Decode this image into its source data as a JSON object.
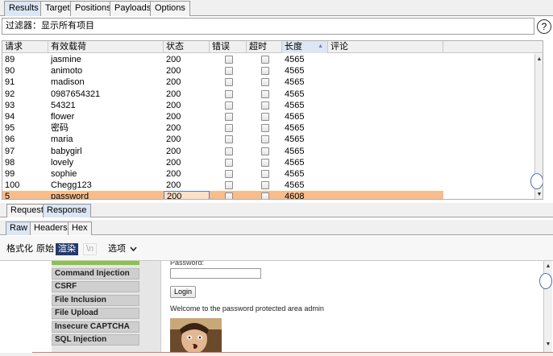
{
  "top_tabs": [
    {
      "label": "Results",
      "active": true
    },
    {
      "label": "Target",
      "active": false
    },
    {
      "label": "Positions",
      "active": false
    },
    {
      "label": "Payloads",
      "active": false
    },
    {
      "label": "Options",
      "active": false
    }
  ],
  "filter": {
    "text": "过滤器：显示所有项目",
    "help": "?"
  },
  "table": {
    "columns": [
      "请求",
      "有效载荷",
      "状态",
      "错误",
      "超时",
      "长度",
      "评论"
    ],
    "sorted_column": "长度",
    "rows": [
      {
        "request": "89",
        "payload": "jasmine",
        "status": "200",
        "length": "4565"
      },
      {
        "request": "90",
        "payload": "animoto",
        "status": "200",
        "length": "4565"
      },
      {
        "request": "91",
        "payload": "madison",
        "status": "200",
        "length": "4565"
      },
      {
        "request": "92",
        "payload": "0987654321",
        "status": "200",
        "length": "4565"
      },
      {
        "request": "93",
        "payload": "54321",
        "status": "200",
        "length": "4565"
      },
      {
        "request": "94",
        "payload": "flower",
        "status": "200",
        "length": "4565"
      },
      {
        "request": "95",
        "payload": "密码",
        "status": "200",
        "length": "4565"
      },
      {
        "request": "96",
        "payload": "maria",
        "status": "200",
        "length": "4565"
      },
      {
        "request": "97",
        "payload": "babygirl",
        "status": "200",
        "length": "4565"
      },
      {
        "request": "98",
        "payload": "lovely",
        "status": "200",
        "length": "4565"
      },
      {
        "request": "99",
        "payload": "sophie",
        "status": "200",
        "length": "4565"
      },
      {
        "request": "100",
        "payload": "Chegg123",
        "status": "200",
        "length": "4565"
      },
      {
        "request": "5",
        "payload": "password",
        "status": "200",
        "length": "4608",
        "selected": true
      }
    ]
  },
  "rr_tabs": [
    {
      "label": "Request",
      "active": false
    },
    {
      "label": "Response",
      "active": true
    }
  ],
  "sub_tabs": [
    {
      "label": "Raw",
      "active": true
    },
    {
      "label": "Headers",
      "active": false
    },
    {
      "label": "Hex",
      "active": false
    }
  ],
  "toolbar": {
    "pretty": "格式化",
    "raw": "原始",
    "render": "渲染",
    "newline": "\\n",
    "options": "选项",
    "chevron": "chevron-down"
  },
  "render": {
    "menu_items": [
      "Command Injection",
      "CSRF",
      "File Inclusion",
      "File Upload",
      "Insecure CAPTCHA",
      "SQL Injection"
    ],
    "password_label": "Password:",
    "login_button": "Login",
    "welcome_text": "Welcome to the password protected area admin"
  },
  "colors": {
    "selected_row": "#f9bc8b",
    "active_tab": "#dce6f4",
    "render_active": "#223a6e",
    "menu_strip": "#8bc34a"
  }
}
